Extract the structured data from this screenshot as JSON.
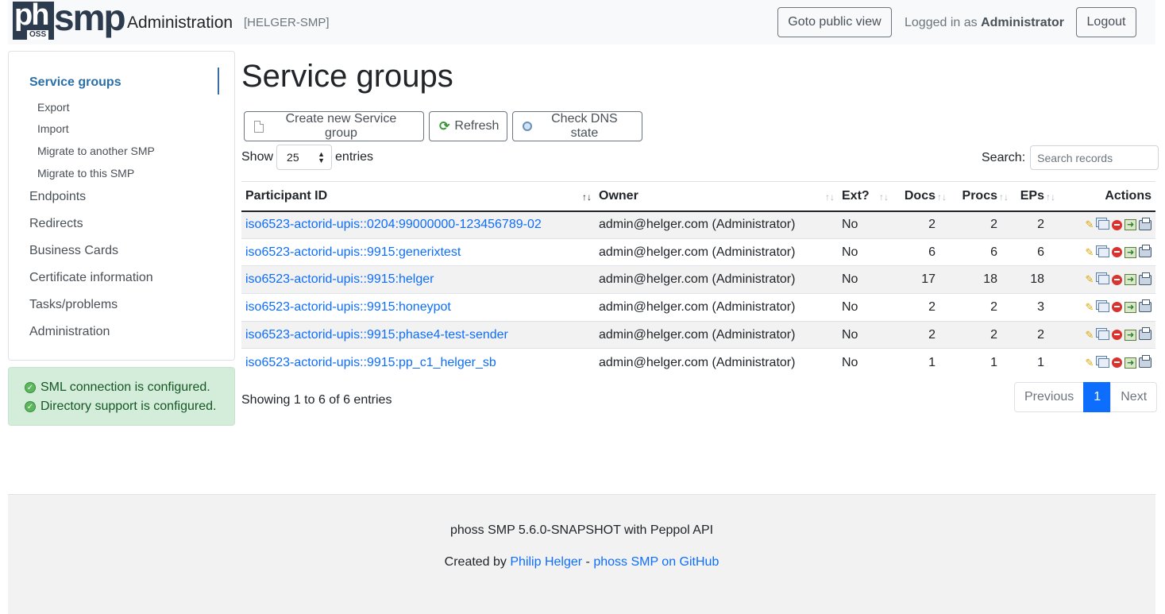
{
  "header": {
    "logo_ph": "ph",
    "logo_oss": "OSS",
    "logo_smp": "smp",
    "title": "Administration",
    "instance_id": "[HELGER-SMP]",
    "public_view_label": "Goto public view",
    "logged_in_prefix": "Logged in as",
    "logged_in_user": "Administrator",
    "logout_label": "Logout"
  },
  "sidebar": {
    "items": [
      {
        "label": "Service groups"
      },
      {
        "label": "Export"
      },
      {
        "label": "Import"
      },
      {
        "label": "Migrate to another SMP"
      },
      {
        "label": "Migrate to this SMP"
      },
      {
        "label": "Endpoints"
      },
      {
        "label": "Redirects"
      },
      {
        "label": "Business Cards"
      },
      {
        "label": "Certificate information"
      },
      {
        "label": "Tasks/problems"
      },
      {
        "label": "Administration"
      }
    ]
  },
  "status": {
    "sml": "SML connection is configured.",
    "directory": "Directory support is configured."
  },
  "main": {
    "title": "Service groups",
    "create_label": "Create new Service group",
    "refresh_label": "Refresh",
    "dns_label": "Check DNS state",
    "show_label": "Show",
    "page_size": "25",
    "entries_label": "entries",
    "search_label": "Search:",
    "search_placeholder": "Search records",
    "columns": {
      "participant": "Participant ID",
      "owner": "Owner",
      "ext": "Ext?",
      "docs": "Docs",
      "procs": "Procs",
      "eps": "EPs",
      "actions": "Actions"
    },
    "rows": [
      {
        "id": "iso6523-actorid-upis::0204:99000000-123456789-02",
        "owner": "admin@helger.com (Administrator)",
        "ext": "No",
        "docs": "2",
        "procs": "2",
        "eps": "2"
      },
      {
        "id": "iso6523-actorid-upis::9915:generixtest",
        "owner": "admin@helger.com (Administrator)",
        "ext": "No",
        "docs": "6",
        "procs": "6",
        "eps": "6"
      },
      {
        "id": "iso6523-actorid-upis::9915:helger",
        "owner": "admin@helger.com (Administrator)",
        "ext": "No",
        "docs": "17",
        "procs": "18",
        "eps": "18"
      },
      {
        "id": "iso6523-actorid-upis::9915:honeypot",
        "owner": "admin@helger.com (Administrator)",
        "ext": "No",
        "docs": "2",
        "procs": "2",
        "eps": "3"
      },
      {
        "id": "iso6523-actorid-upis::9915:phase4-test-sender",
        "owner": "admin@helger.com (Administrator)",
        "ext": "No",
        "docs": "2",
        "procs": "2",
        "eps": "2"
      },
      {
        "id": "iso6523-actorid-upis::9915:pp_c1_helger_sb",
        "owner": "admin@helger.com (Administrator)",
        "ext": "No",
        "docs": "1",
        "procs": "1",
        "eps": "1"
      }
    ],
    "info": "Showing 1 to 6 of 6 entries",
    "pager": {
      "previous": "Previous",
      "current": "1",
      "next": "Next"
    }
  },
  "footer": {
    "version": "phoss SMP 5.6.0-SNAPSHOT with Peppol API",
    "created_by": "Created by",
    "author": "Philip Helger",
    "sep": "-",
    "github": "phoss SMP on GitHub"
  }
}
